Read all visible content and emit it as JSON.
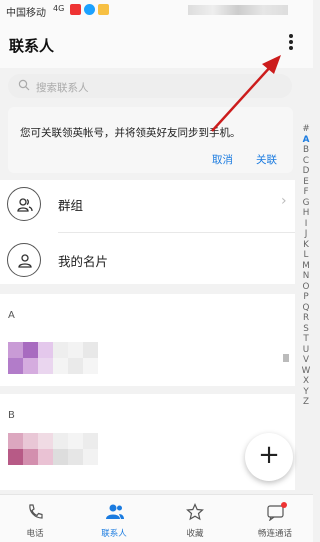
{
  "statusbar": {
    "carrier": "中国移动",
    "signal": "4G"
  },
  "header": {
    "title": "联系人"
  },
  "search": {
    "placeholder": "搜索联系人"
  },
  "prompt": {
    "message": "您可关联领英帐号，并将领英好友同步到手机。",
    "cancel": "取消",
    "close": "关联"
  },
  "rows": {
    "groups": "群组",
    "my_card": "我的名片"
  },
  "groups": {
    "a": "A",
    "b": "B"
  },
  "alphabet": [
    "#",
    "A",
    "B",
    "C",
    "D",
    "E",
    "F",
    "G",
    "H",
    "I",
    "J",
    "K",
    "L",
    "M",
    "N",
    "O",
    "P",
    "Q",
    "R",
    "S",
    "T",
    "U",
    "V",
    "W",
    "X",
    "Y",
    "Z"
  ],
  "fab": {
    "label": "+"
  },
  "nav": {
    "phone": "电话",
    "contacts": "联系人",
    "favorites": "收藏",
    "caas": "畅连通话"
  },
  "colors": {
    "accent": "#1a7be0",
    "arrow": "#cc1c1c"
  }
}
